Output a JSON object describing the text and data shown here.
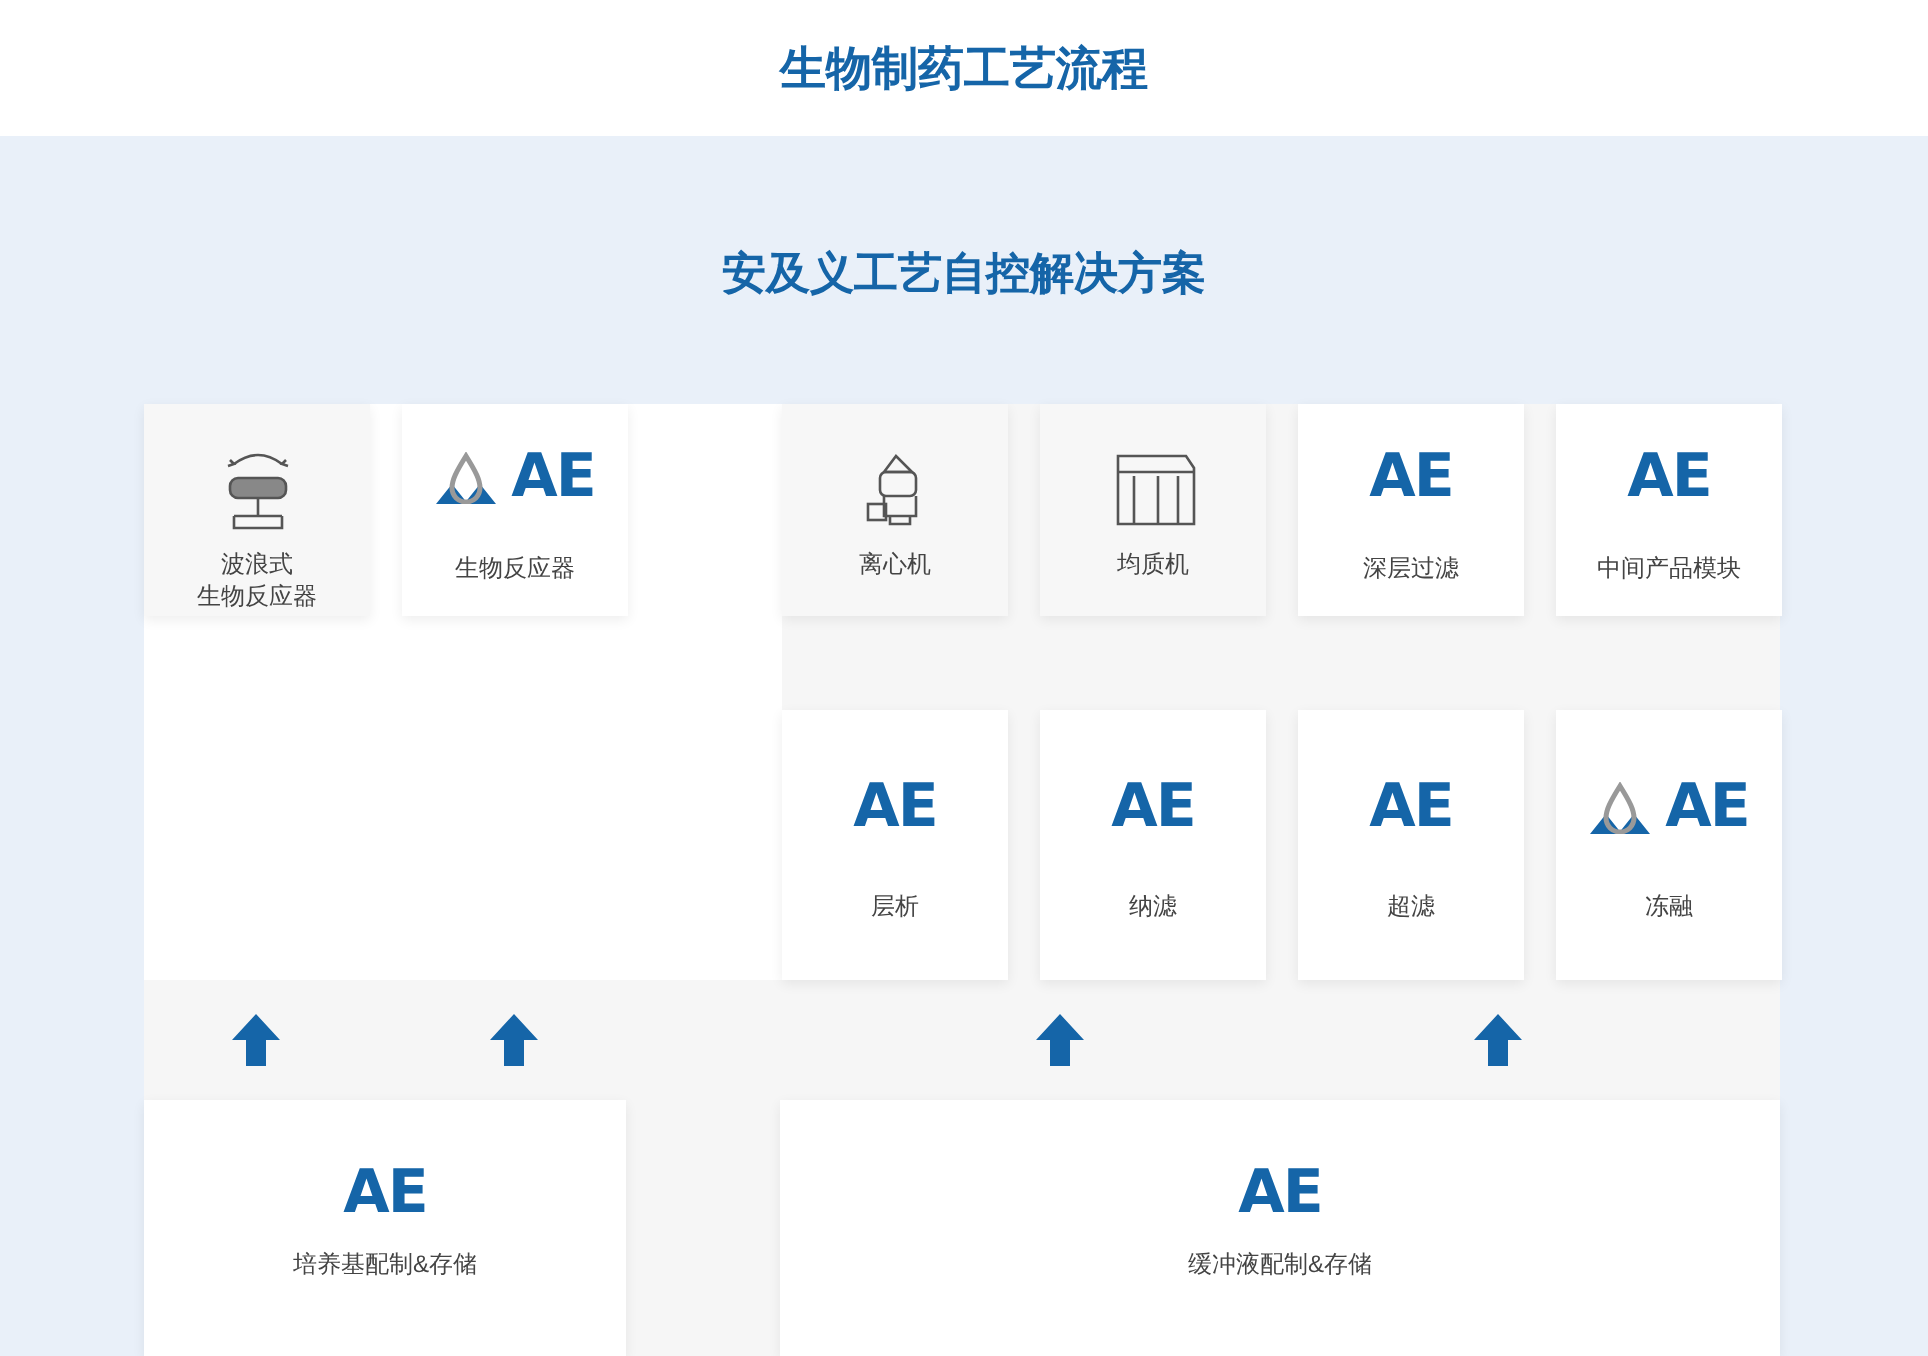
{
  "title": "生物制药工艺流程",
  "subtitle": "安及义工艺自控解决方案",
  "top_row": [
    {
      "kind": "equipment",
      "label": [
        "波浪式",
        "生物反应器"
      ]
    },
    {
      "kind": "brand",
      "logo": "AE",
      "drop": true,
      "label": "生物反应器"
    },
    {
      "kind": "equipment",
      "label": "离心机"
    },
    {
      "kind": "equipment",
      "label": "均质机"
    },
    {
      "kind": "brand",
      "logo": "AE",
      "drop": false,
      "label": "深层过滤"
    },
    {
      "kind": "brand",
      "logo": "AE",
      "drop": false,
      "label": "中间产品模块"
    }
  ],
  "middle_row": [
    {
      "kind": "brand",
      "logo": "AE",
      "drop": false,
      "label": "层析"
    },
    {
      "kind": "brand",
      "logo": "AE",
      "drop": false,
      "label": "纳滤"
    },
    {
      "kind": "brand",
      "logo": "AE",
      "drop": false,
      "label": "超滤"
    },
    {
      "kind": "brand",
      "logo": "AE",
      "drop": true,
      "label": "冻融"
    }
  ],
  "bottom_row": [
    {
      "kind": "brand",
      "logo": "AE",
      "drop": false,
      "label": "培养基配制&存储"
    },
    {
      "kind": "brand",
      "logo": "AE",
      "drop": false,
      "label": "缓冲液配制&存储"
    }
  ]
}
